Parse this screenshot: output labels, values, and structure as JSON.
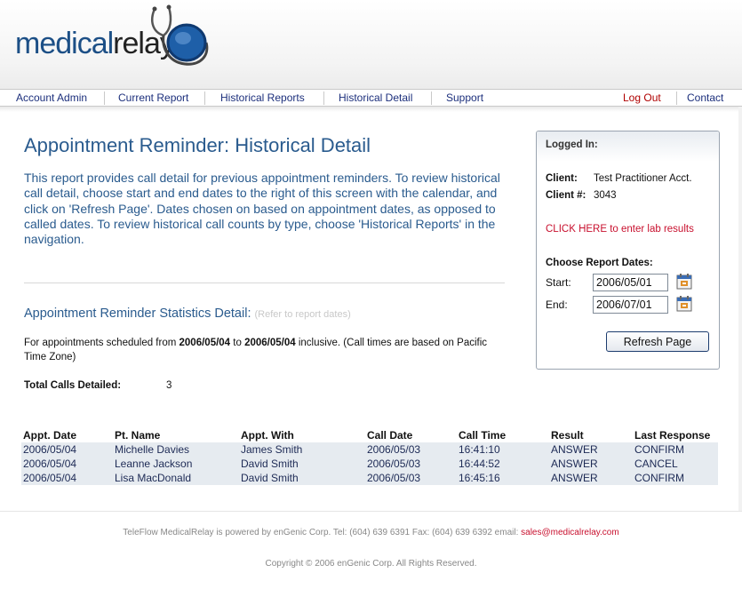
{
  "brand": {
    "part1": "medical",
    "part2": "relay"
  },
  "nav": {
    "left": [
      "Account Admin",
      "Current Report",
      "Historical Reports",
      "Historical Detail",
      "Support"
    ],
    "logout": "Log Out",
    "contact": "Contact"
  },
  "page": {
    "title": "Appointment Reminder: Historical Detail",
    "intro": "This report provides call detail for previous appointment reminders.  To review historical call detail, choose start and end dates to the right of this screen with the calendar, and click on 'Refresh Page'.  Dates chosen on based on appointment dates, as opposed to called dates.  To review historical call counts by type, choose 'Historical Reports' in the navigation."
  },
  "stats": {
    "title": "Appointment Reminder Statistics Detail:",
    "note": "(Refer to report dates)",
    "sched_prefix": "For appointments scheduled from ",
    "from": "2006/05/04",
    "to_word": " to ",
    "to": "2006/05/04",
    "sched_suffix": " inclusive. (Call times are based on Pacific Time Zone)",
    "total_label": "Total Calls Detailed:",
    "total_value": "3"
  },
  "table": {
    "headers": [
      "Appt. Date",
      "Pt. Name",
      "Appt. With",
      "Call Date",
      "Call Time",
      "Result",
      "Last Response"
    ],
    "rows": [
      [
        "2006/05/04",
        "Michelle Davies",
        "James Smith",
        "2006/05/03",
        "16:41:10",
        "ANSWER",
        "CONFIRM"
      ],
      [
        "2006/05/04",
        "Leanne Jackson",
        "David Smith",
        "2006/05/03",
        "16:44:52",
        "ANSWER",
        "CANCEL"
      ],
      [
        "2006/05/04",
        "Lisa MacDonald",
        "David Smith",
        "2006/05/03",
        "16:45:16",
        "ANSWER",
        "CONFIRM"
      ]
    ]
  },
  "panel": {
    "title": "Logged In:",
    "client_label": "Client:",
    "client_value": "Test Practitioner Acct.",
    "client_no_label": "Client #:",
    "client_no_value": "3043",
    "lab_link": "CLICK HERE to enter lab results",
    "choose_label": "Choose Report Dates:",
    "start_label": "Start:",
    "start_value": "2006/05/01",
    "end_label": "End:",
    "end_value": "2006/07/01",
    "refresh_label": "Refresh Page"
  },
  "footer": {
    "powered": "TeleFlow MedicalRelay is powered by enGenic Corp.  Tel: (604) 639 6391  Fax: (604) 639 6392 email: ",
    "email": "sales@medicalrelay.com",
    "copyright": "Copyright © 2006 enGenic Corp. All Rights Reserved."
  },
  "colors": {
    "brand_blue": "#1c4f86",
    "nav_text": "#1c2f7c",
    "title_blue": "#2a5b8e",
    "alert_red": "#c8102e",
    "row_bg": "#e6ebf0"
  }
}
